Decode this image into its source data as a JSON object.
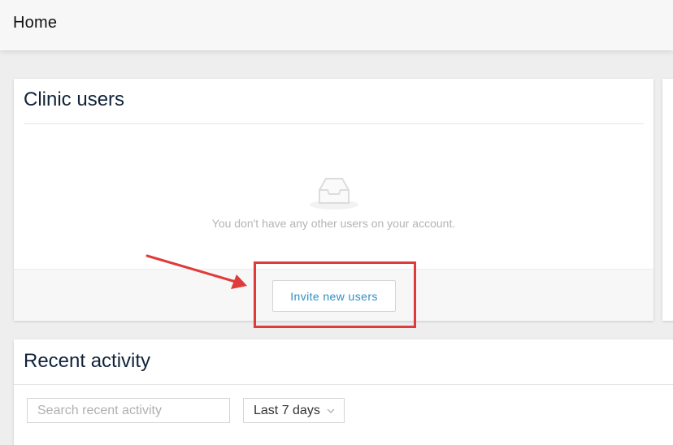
{
  "header": {
    "title": "Home"
  },
  "clinic_users": {
    "title": "Clinic users",
    "empty_message": "You don't have any other users on your account.",
    "invite_button": "Invite new users"
  },
  "recent_activity": {
    "title": "Recent activity",
    "search_placeholder": "Search recent activity",
    "range_selected": "Last 7 days"
  },
  "annotation": {
    "highlight_color": "#e03a3a"
  },
  "icons": [
    "empty-inbox-icon",
    "chevron-down-icon",
    "annotation-arrow-icon"
  ]
}
